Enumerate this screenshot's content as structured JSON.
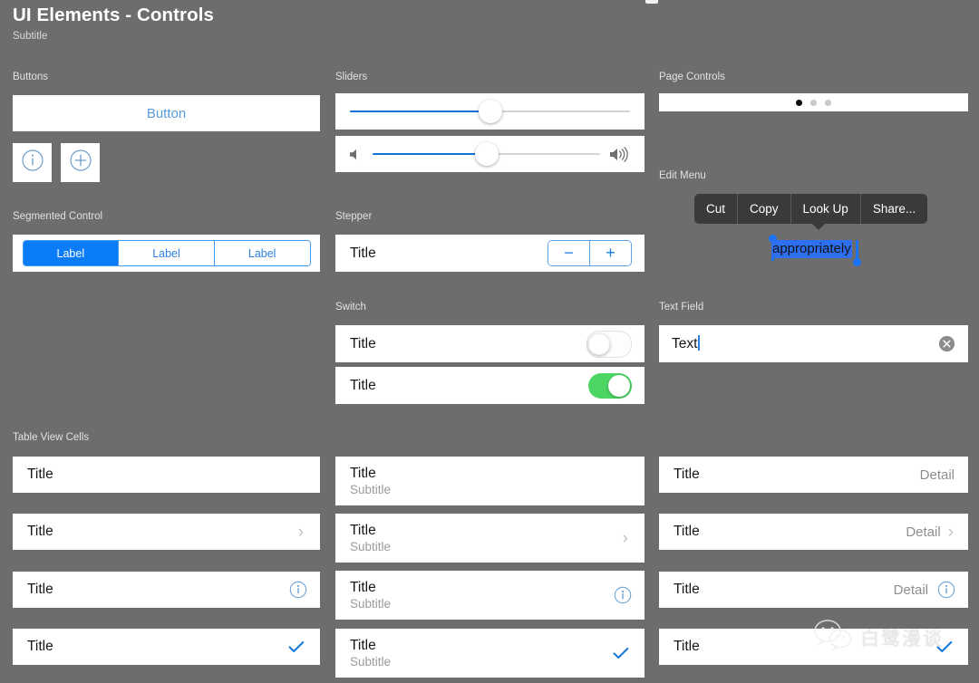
{
  "header": {
    "title": "UI Elements - Controls",
    "subtitle": "Subtitle"
  },
  "sections": {
    "buttons": "Buttons",
    "segmented_control": "Segmented Control",
    "sliders": "Sliders",
    "stepper": "Stepper",
    "switch": "Switch",
    "page_controls": "Page Controls",
    "edit_menu": "Edit Menu",
    "text_field": "Text Field",
    "table_view_cells": "Table View Cells"
  },
  "buttons": {
    "main_label": "Button",
    "info_icon": "info-circle-icon",
    "add_icon": "plus-circle-icon"
  },
  "segmented": {
    "items": [
      {
        "label": "Label",
        "selected": true
      },
      {
        "label": "Label",
        "selected": false
      },
      {
        "label": "Label",
        "selected": false
      }
    ]
  },
  "sliders": [
    {
      "value": 50,
      "min_icon": "",
      "max_icon": ""
    },
    {
      "value": 50,
      "min_icon": "speaker-low-icon",
      "max_icon": "speaker-high-icon"
    }
  ],
  "stepper": {
    "title": "Title",
    "decrement_label": "−",
    "increment_label": "+"
  },
  "switches": [
    {
      "title": "Title",
      "on": false
    },
    {
      "title": "Title",
      "on": true
    }
  ],
  "page_control": {
    "total": 3,
    "current": 1
  },
  "edit_menu": {
    "items": [
      "Cut",
      "Copy",
      "Look Up",
      "Share..."
    ],
    "selected_text": "appropriately"
  },
  "text_field": {
    "value": "Text",
    "placeholder": "Text",
    "clear_icon": "clear-circle-icon"
  },
  "table_cells": {
    "column1": [
      {
        "title": "Title",
        "accessory": "none"
      },
      {
        "title": "Title",
        "accessory": "chevron"
      },
      {
        "title": "Title",
        "accessory": "info"
      },
      {
        "title": "Title",
        "accessory": "check"
      }
    ],
    "column2": [
      {
        "title": "Title",
        "subtitle": "Subtitle",
        "accessory": "none"
      },
      {
        "title": "Title",
        "subtitle": "Subtitle",
        "accessory": "chevron"
      },
      {
        "title": "Title",
        "subtitle": "Subtitle",
        "accessory": "info"
      },
      {
        "title": "Title",
        "subtitle": "Subtitle",
        "accessory": "check"
      }
    ],
    "column3": [
      {
        "title": "Title",
        "detail": "Detail",
        "accessory": "none"
      },
      {
        "title": "Title",
        "detail": "Detail",
        "accessory": "chevron"
      },
      {
        "title": "Title",
        "detail": "Detail",
        "accessory": "info"
      },
      {
        "title": "Title",
        "detail": "",
        "accessory": "check"
      }
    ]
  },
  "watermark": {
    "text": "白鹭漫谈",
    "icon": "wechat-icon"
  },
  "colors": {
    "background": "#6d6d6d",
    "card": "#ffffff",
    "accent_blue": "#0a7cf7",
    "link_blue": "#5a9bd8",
    "switch_on_green": "#4bd663",
    "menu_dark": "#3a3a3c",
    "selection_blue": "#2e6ff2"
  }
}
